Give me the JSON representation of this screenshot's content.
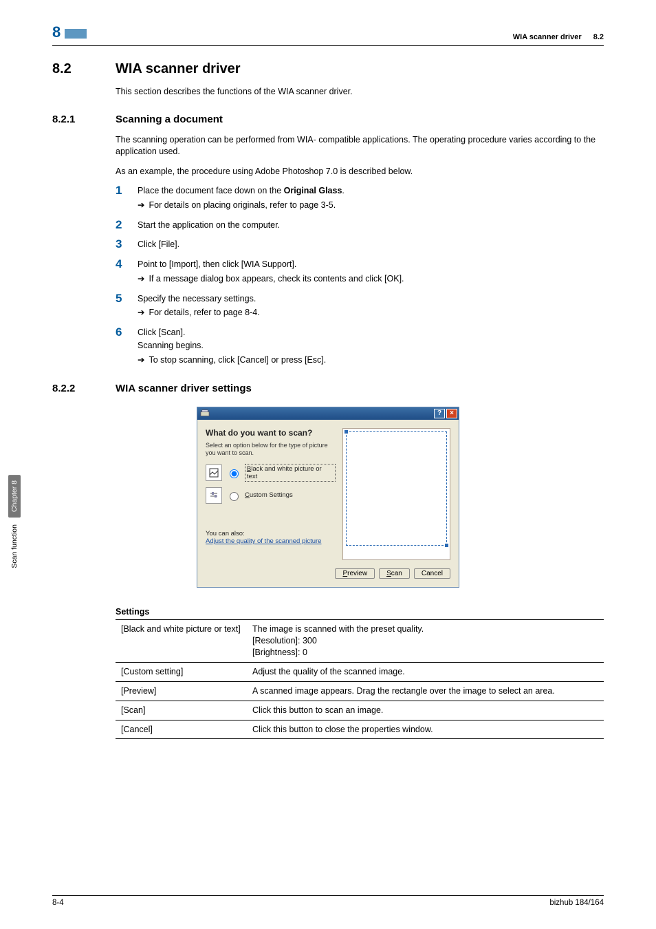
{
  "header": {
    "chapter_number": "8",
    "running_title": "WIA scanner driver",
    "running_section": "8.2"
  },
  "h1": {
    "num": "8.2",
    "txt": "WIA scanner driver"
  },
  "intro": "This section describes the functions of the WIA scanner driver.",
  "h2a": {
    "num": "8.2.1",
    "txt": "Scanning a document"
  },
  "p821a": "The scanning operation can be performed from WIA- compatible applications. The operating procedure varies according to the application used.",
  "p821b": "As an example, the procedure using Adobe Photoshop 7.0 is described below.",
  "steps": [
    {
      "n": "1",
      "main_pre": "Place the document face down on the ",
      "main_bold": "Original Glass",
      "main_post": ".",
      "subs": [
        "For details on placing originals, refer to page 3-5."
      ]
    },
    {
      "n": "2",
      "main": "Start the application on the computer.",
      "subs": []
    },
    {
      "n": "3",
      "main": "Click [File].",
      "subs": []
    },
    {
      "n": "4",
      "main": "Point to [Import], then click [WIA Support].",
      "subs": [
        "If a message dialog box appears, check its contents and click [OK]."
      ]
    },
    {
      "n": "5",
      "main": "Specify the necessary settings.",
      "subs": [
        "For details, refer to page 8-4."
      ]
    },
    {
      "n": "6",
      "main": "Click [Scan].",
      "extra": "Scanning begins.",
      "subs": [
        "To stop scanning, click [Cancel] or press [Esc]."
      ]
    }
  ],
  "h2b": {
    "num": "8.2.2",
    "txt": "WIA scanner driver settings"
  },
  "dialog": {
    "question": "What do you want to scan?",
    "sub": "Select an option below for the type of picture you want to scan.",
    "opt_bw_pre": "B",
    "opt_bw": "lack and white picture or text",
    "opt_custom_pre": "C",
    "opt_custom": "ustom Settings",
    "also": "You can also:",
    "link": "Adjust the quality of the scanned picture",
    "btn_preview_pre": "P",
    "btn_preview": "review",
    "btn_scan_pre": "S",
    "btn_scan": "can",
    "btn_cancel": "Cancel"
  },
  "settings": {
    "title": "Settings",
    "rows": [
      {
        "k": "[Black and white picture or text]",
        "v": "The image is scanned with the preset quality.\n[Resolution]: 300\n[Brightness]: 0"
      },
      {
        "k": "[Custom setting]",
        "v": "Adjust the quality of the scanned image."
      },
      {
        "k": "[Preview]",
        "v": "A scanned image appears. Drag the rectangle over the image to select an area."
      },
      {
        "k": "[Scan]",
        "v": "Click this button to scan an image."
      },
      {
        "k": "[Cancel]",
        "v": "Click this button to close the properties window."
      }
    ]
  },
  "sidetab": {
    "chapter": "Chapter 8",
    "label": "Scan function"
  },
  "footer": {
    "left": "8-4",
    "right": "bizhub 184/164"
  }
}
